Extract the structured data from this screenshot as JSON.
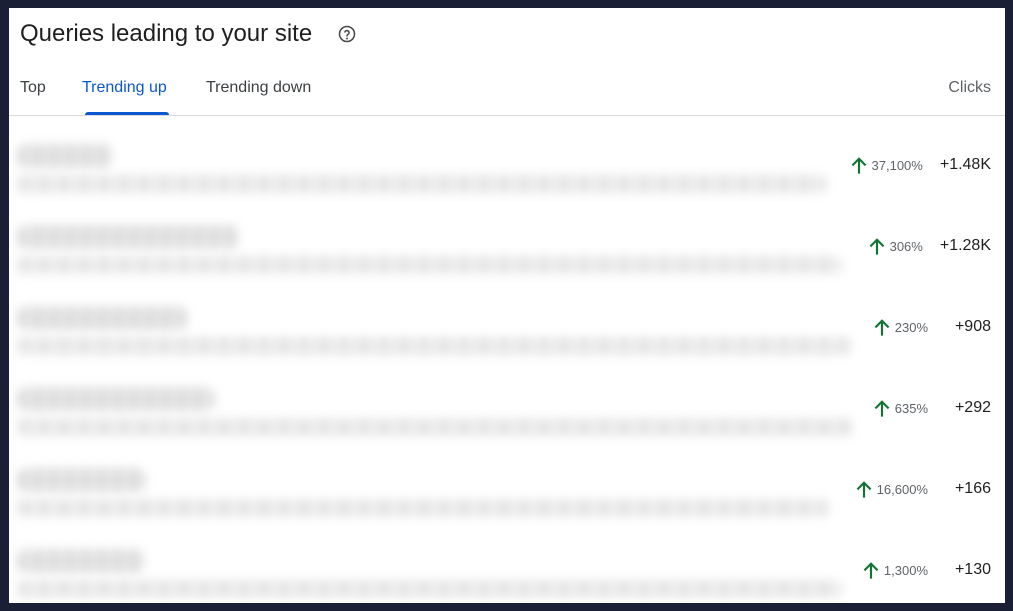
{
  "card": {
    "title": "Queries leading to your site",
    "help_icon": "help-circle-icon"
  },
  "tabs": [
    {
      "label": "Top",
      "active": false
    },
    {
      "label": "Trending up",
      "active": true
    },
    {
      "label": "Trending down",
      "active": false
    }
  ],
  "columns": {
    "clicks": "Clicks"
  },
  "colors": {
    "accent": "#0b57d0",
    "trend_up": "#137333",
    "background": "#1b1f36"
  },
  "rows": [
    {
      "query": "",
      "change_pct": "37,100%",
      "clicks_delta": "+1.48K",
      "trend": "up",
      "trend_icon": "arrow-up-icon"
    },
    {
      "query": "",
      "change_pct": "306%",
      "clicks_delta": "+1.28K",
      "trend": "up",
      "trend_icon": "arrow-up-icon"
    },
    {
      "query": "",
      "change_pct": "230%",
      "clicks_delta": "+908",
      "trend": "up",
      "trend_icon": "arrow-up-icon"
    },
    {
      "query": "",
      "change_pct": "635%",
      "clicks_delta": "+292",
      "trend": "up",
      "trend_icon": "arrow-up-icon"
    },
    {
      "query": "",
      "change_pct": "16,600%",
      "clicks_delta": "+166",
      "trend": "up",
      "trend_icon": "arrow-up-icon"
    },
    {
      "query": "",
      "change_pct": "1,300%",
      "clicks_delta": "+130",
      "trend": "up",
      "trend_icon": "arrow-up-icon"
    }
  ]
}
